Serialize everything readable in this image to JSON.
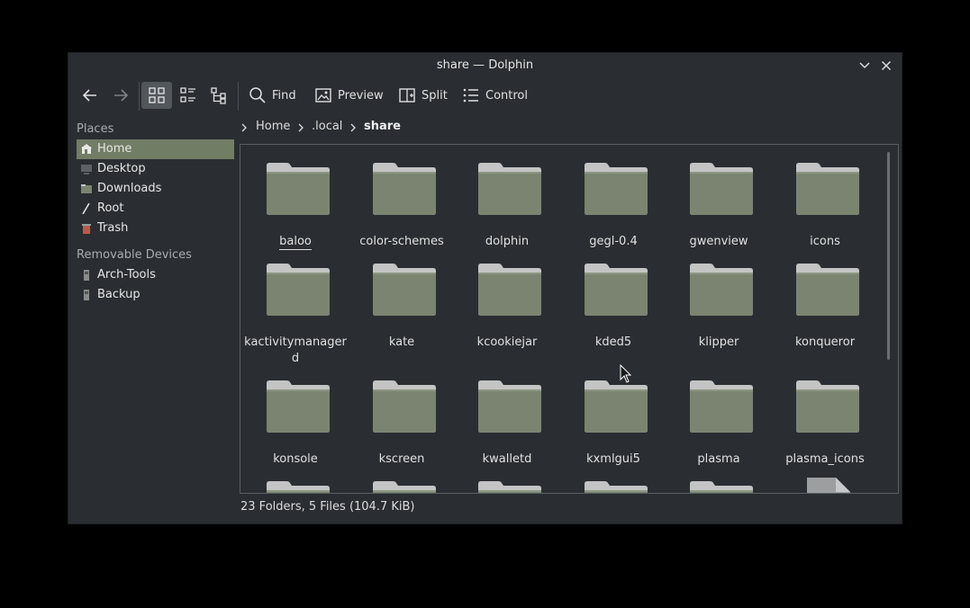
{
  "window": {
    "title": "share — Dolphin"
  },
  "toolbar": {
    "find": "Find",
    "preview": "Preview",
    "split": "Split",
    "control": "Control"
  },
  "sidebar": {
    "places_title": "Places",
    "places": [
      {
        "label": "Home",
        "icon": "home-icon",
        "active": true
      },
      {
        "label": "Desktop",
        "icon": "desktop-icon"
      },
      {
        "label": "Downloads",
        "icon": "downloads-icon"
      },
      {
        "label": "Root",
        "icon": "root-icon"
      },
      {
        "label": "Trash",
        "icon": "trash-icon"
      }
    ],
    "devices_title": "Removable Devices",
    "devices": [
      {
        "label": "Arch-Tools",
        "icon": "drive-icon"
      },
      {
        "label": "Backup",
        "icon": "drive-icon"
      }
    ]
  },
  "breadcrumb": [
    "Home",
    ".local",
    "share"
  ],
  "files": [
    "baloo",
    "color-schemes",
    "dolphin",
    "gegl-0.4",
    "gwenview",
    "icons",
    "kactivitymanagerd",
    "kate",
    "kcookiejar",
    "kded5",
    "klipper",
    "konqueror",
    "konsole",
    "kscreen",
    "kwalletd",
    "kxmlgui5",
    "plasma",
    "plasma_icons"
  ],
  "status": "23 Folders, 5 Files (104.7 KiB)",
  "colors": {
    "folder": "#7a8471",
    "folder_tab": "#c4c4c4",
    "highlight": "#727d65"
  }
}
